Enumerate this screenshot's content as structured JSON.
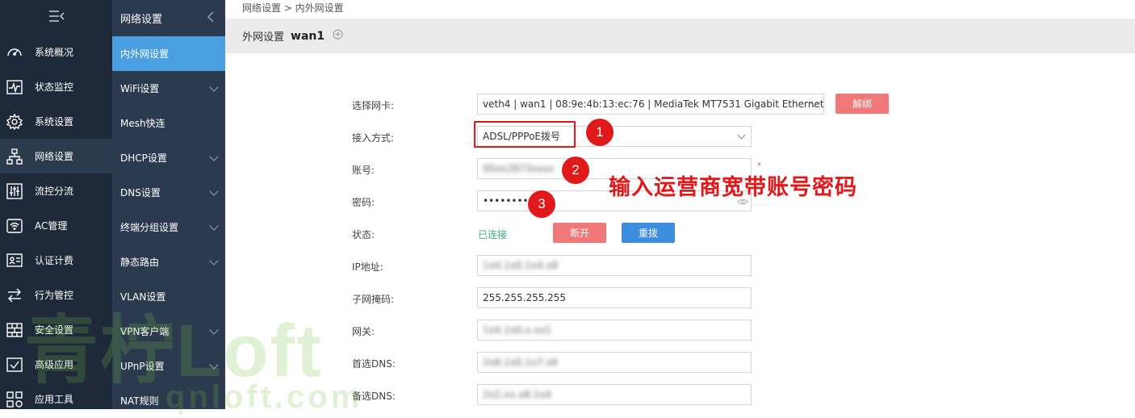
{
  "sidebar": {
    "toggle_icon": "menu-collapse-icon",
    "items": [
      {
        "label": "系统概况",
        "icon": "dashboard-icon"
      },
      {
        "label": "状态监控",
        "icon": "pulse-icon"
      },
      {
        "label": "系统设置",
        "icon": "gear-icon"
      },
      {
        "label": "网络设置",
        "icon": "network-icon"
      },
      {
        "label": "流控分流",
        "icon": "sliders-icon"
      },
      {
        "label": "AC管理",
        "icon": "wifi-ap-icon"
      },
      {
        "label": "认证计费",
        "icon": "id-card-icon"
      },
      {
        "label": "行为管控",
        "icon": "swap-arrows-icon"
      },
      {
        "label": "安全设置",
        "icon": "firewall-icon"
      },
      {
        "label": "高级应用",
        "icon": "check-box-icon"
      },
      {
        "label": "应用工具",
        "icon": "apps-icon"
      }
    ]
  },
  "submenu": {
    "title": "网络设置",
    "items": [
      {
        "label": "内外网设置"
      },
      {
        "label": "WiFi设置"
      },
      {
        "label": "Mesh快连"
      },
      {
        "label": "DHCP设置"
      },
      {
        "label": "DNS设置"
      },
      {
        "label": "终端分组设置"
      },
      {
        "label": "静态路由"
      },
      {
        "label": "VLAN设置"
      },
      {
        "label": "VPN客户端"
      },
      {
        "label": "UPnP设置"
      },
      {
        "label": "NAT规则"
      }
    ]
  },
  "breadcrumb": "网络设置 > 内外网设置",
  "titlebar": {
    "title": "外网设置",
    "name": "wan1",
    "add_icon": "plus-circle-icon"
  },
  "form": {
    "nic": {
      "label": "选择网卡:",
      "value": "veth4 | wan1 | 08:9e:4b:13:ec:76 | MediaTek MT7531 Gigabit Ethernet Controller",
      "unbind_label": "解绑"
    },
    "access": {
      "label": "接入方式:",
      "value": "ADSL/PPPoE拨号"
    },
    "account": {
      "label": "账号:",
      "value": "95xx2873xxxx",
      "required_mark": "*"
    },
    "password": {
      "label": "密码:",
      "value": "••••••••",
      "eye_icon": "eye-icon"
    },
    "status": {
      "label": "状态:",
      "value": "已连接",
      "disconnect_label": "断开",
      "redial_label": "重拨"
    },
    "ip": {
      "label": "IP地址:",
      "value": "1x4.1x0.1x4.x8"
    },
    "mask": {
      "label": "子网掩码:",
      "value": "255.255.255.255"
    },
    "gateway": {
      "label": "网关:",
      "value": "1x4.1x0.x.xx1"
    },
    "dns1": {
      "label": "首选DNS:",
      "value": "2x8.1x0.1x7.x6"
    },
    "dns2": {
      "label": "备选DNS:",
      "value": "2x2.xx.x8.1x4"
    }
  },
  "annotations": {
    "badge1": "1",
    "badge2": "2",
    "badge3": "3",
    "note": "输入运营商宽带账号密码"
  },
  "watermark": {
    "main": "青柠Loft",
    "sub": "qnloft.com"
  },
  "colors": {
    "sidebar": "#1e2a3a",
    "submenu": "#2b3a4e",
    "active": "#4a9fe0",
    "pink": "#f07878",
    "blue": "#3c8ddd",
    "red": "#e0191b",
    "green": "#3bb27a"
  }
}
